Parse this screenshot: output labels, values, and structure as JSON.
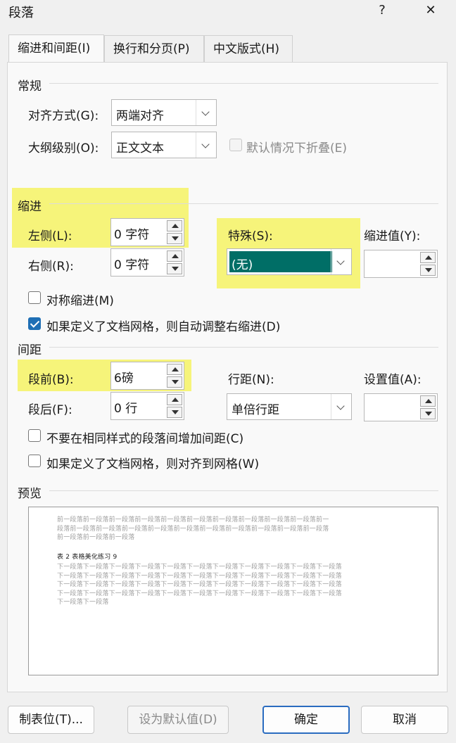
{
  "window": {
    "title": "段落",
    "help": "?",
    "close": "✕"
  },
  "tabs": [
    "缩进和间距(I)",
    "换行和分页(P)",
    "中文版式(H)"
  ],
  "general": {
    "heading": "常规",
    "align_label": "对齐方式(G):",
    "align_value": "两端对齐",
    "outline_label": "大纲级别(O):",
    "outline_value": "正文文本",
    "collapse_label": "默认情况下折叠(E)"
  },
  "indent": {
    "heading": "缩进",
    "left_label": "左侧(L):",
    "left_value": "0 字符",
    "right_label": "右侧(R):",
    "right_value": "0 字符",
    "special_label": "特殊(S):",
    "special_value": "(无)",
    "by_label": "缩进值(Y):",
    "by_value": "",
    "mirror_label": "对称缩进(M)",
    "autoadjust_label": "如果定义了文档网格，则自动调整右缩进(D)",
    "mirror_checked": false,
    "autoadjust_checked": true
  },
  "spacing": {
    "heading": "间距",
    "before_label": "段前(B):",
    "before_value": "6磅",
    "after_label": "段后(F):",
    "after_value": "0 行",
    "line_label": "行距(N):",
    "line_value": "单倍行距",
    "at_label": "设置值(A):",
    "at_value": "",
    "nospace_label": "不要在相同样式的段落间增加间距(C)",
    "snapgrid_label": "如果定义了文档网格，则对齐到网格(W)",
    "nospace_checked": false,
    "snapgrid_checked": false
  },
  "preview": {
    "heading": "预览",
    "prev_lines": [
      "前一段落前一段落前一段落前一段落前一段落前一段落前一段落前一段落前一段落前一段落前一",
      "段落前一段落前一段落前一段落前一段落前一段落前一段落前一段落前一段落前一段落前一段落",
      "前一段落前一段落前一段落"
    ],
    "current_line": "表 2  表格美化练习 9",
    "next_lines": [
      "下一段落下一段落下一段落下一段落下一段落下一段落下一段落下一段落下一段落下一段落下一段落",
      "下一段落下一段落下一段落下一段落下一段落下一段落下一段落下一段落下一段落下一段落下一段落",
      "下一段落下一段落下一段落下一段落下一段落下一段落下一段落下一段落下一段落下一段落下一段落",
      "下一段落下一段落下一段落下一段落下一段落下一段落下一段落下一段落下一段落下一段落下一段落",
      "下一段落下一段落"
    ]
  },
  "buttons": {
    "tabs": "制表位(T)...",
    "default": "设为默认值(D)",
    "ok": "确定",
    "cancel": "取消"
  },
  "colors": {
    "highlight": "#f6f47a",
    "selection": "#006e66"
  }
}
